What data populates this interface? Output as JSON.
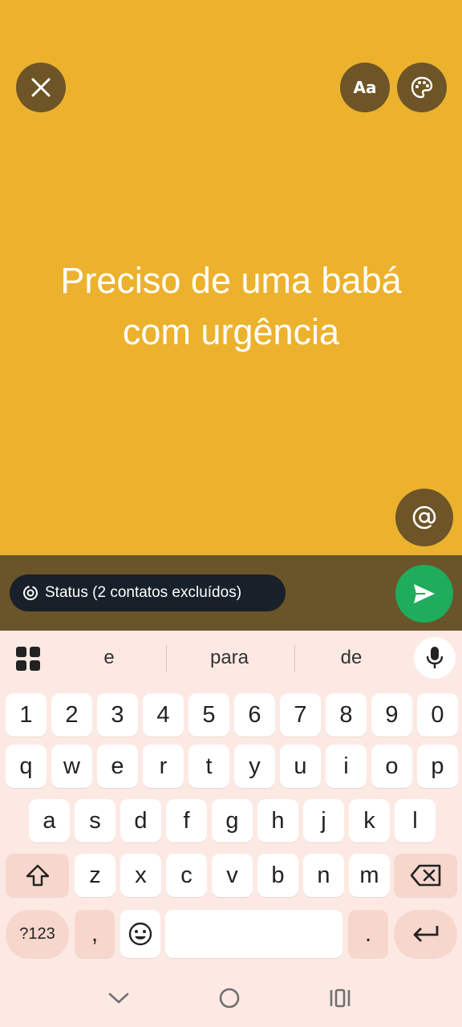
{
  "composer": {
    "status_text": "Preciso de uma babá com urgência",
    "font_button_label": "Aa",
    "background_color": "#ecb22e",
    "icons": {
      "close": "close-icon",
      "palette": "palette-icon",
      "mention": "at-sign-icon",
      "send": "send-icon"
    }
  },
  "audience": {
    "label": "Status (2 contatos excluídos)"
  },
  "keyboard": {
    "suggestions": [
      "e",
      "para",
      "de"
    ],
    "row_numbers": [
      "1",
      "2",
      "3",
      "4",
      "5",
      "6",
      "7",
      "8",
      "9",
      "0"
    ],
    "row_1": [
      "q",
      "w",
      "e",
      "r",
      "t",
      "y",
      "u",
      "i",
      "o",
      "p"
    ],
    "row_2": [
      "a",
      "s",
      "d",
      "f",
      "g",
      "h",
      "j",
      "k",
      "l"
    ],
    "row_3": [
      "z",
      "x",
      "c",
      "v",
      "b",
      "n",
      "m"
    ],
    "symbols_key": "?123",
    "comma_key": ",",
    "period_key": "."
  },
  "navbar": {
    "icons": [
      "back-chevron-icon",
      "home-circle-icon",
      "recent-apps-icon"
    ]
  }
}
